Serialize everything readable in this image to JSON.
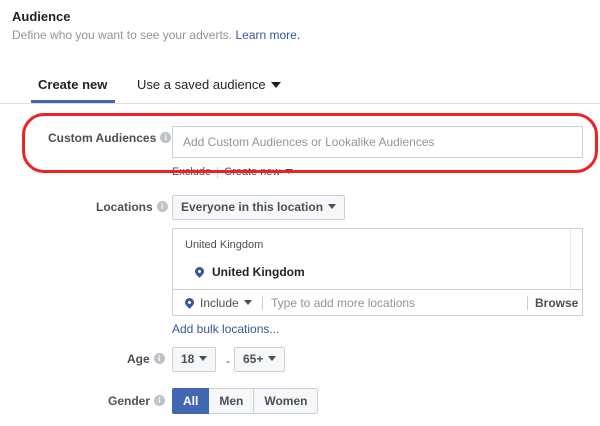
{
  "header": {
    "title": "Audience",
    "subtitle": "Define who you want to see your adverts.",
    "learn_more": "Learn more."
  },
  "tabs": {
    "create_new": "Create new",
    "saved_audience": "Use a saved audience"
  },
  "custom_audiences": {
    "label": "Custom Audiences",
    "placeholder": "Add Custom Audiences or Lookalike Audiences",
    "exclude": "Exclude",
    "create_new": "Create new"
  },
  "locations": {
    "label": "Locations",
    "mode": "Everyone in this location",
    "region": "United Kingdom",
    "selected": "United Kingdom",
    "include": "Include",
    "placeholder": "Type to add more locations",
    "browse": "Browse",
    "bulk_link": "Add bulk locations..."
  },
  "age": {
    "label": "Age",
    "min": "18",
    "separator": "-",
    "max": "65+"
  },
  "gender": {
    "label": "Gender",
    "options": [
      "All",
      "Men",
      "Women"
    ],
    "selected": "All"
  },
  "colors": {
    "accent": "#4267b2",
    "link": "#365899",
    "highlight": "#ed2224"
  },
  "icons": [
    "info-icon",
    "caret-down-icon",
    "location-pin-icon"
  ]
}
